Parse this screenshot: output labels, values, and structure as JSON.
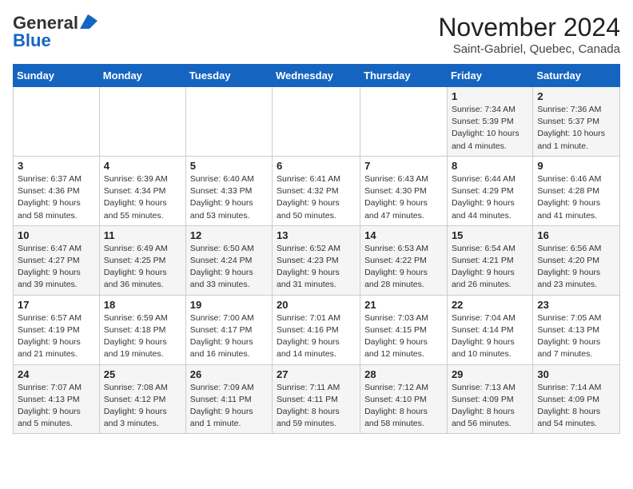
{
  "header": {
    "logo_line1": "General",
    "logo_line2": "Blue",
    "month": "November 2024",
    "location": "Saint-Gabriel, Quebec, Canada"
  },
  "days_of_week": [
    "Sunday",
    "Monday",
    "Tuesday",
    "Wednesday",
    "Thursday",
    "Friday",
    "Saturday"
  ],
  "weeks": [
    [
      {
        "day": "",
        "detail": ""
      },
      {
        "day": "",
        "detail": ""
      },
      {
        "day": "",
        "detail": ""
      },
      {
        "day": "",
        "detail": ""
      },
      {
        "day": "",
        "detail": ""
      },
      {
        "day": "1",
        "detail": "Sunrise: 7:34 AM\nSunset: 5:39 PM\nDaylight: 10 hours\nand 4 minutes."
      },
      {
        "day": "2",
        "detail": "Sunrise: 7:36 AM\nSunset: 5:37 PM\nDaylight: 10 hours\nand 1 minute."
      }
    ],
    [
      {
        "day": "3",
        "detail": "Sunrise: 6:37 AM\nSunset: 4:36 PM\nDaylight: 9 hours\nand 58 minutes."
      },
      {
        "day": "4",
        "detail": "Sunrise: 6:39 AM\nSunset: 4:34 PM\nDaylight: 9 hours\nand 55 minutes."
      },
      {
        "day": "5",
        "detail": "Sunrise: 6:40 AM\nSunset: 4:33 PM\nDaylight: 9 hours\nand 53 minutes."
      },
      {
        "day": "6",
        "detail": "Sunrise: 6:41 AM\nSunset: 4:32 PM\nDaylight: 9 hours\nand 50 minutes."
      },
      {
        "day": "7",
        "detail": "Sunrise: 6:43 AM\nSunset: 4:30 PM\nDaylight: 9 hours\nand 47 minutes."
      },
      {
        "day": "8",
        "detail": "Sunrise: 6:44 AM\nSunset: 4:29 PM\nDaylight: 9 hours\nand 44 minutes."
      },
      {
        "day": "9",
        "detail": "Sunrise: 6:46 AM\nSunset: 4:28 PM\nDaylight: 9 hours\nand 41 minutes."
      }
    ],
    [
      {
        "day": "10",
        "detail": "Sunrise: 6:47 AM\nSunset: 4:27 PM\nDaylight: 9 hours\nand 39 minutes."
      },
      {
        "day": "11",
        "detail": "Sunrise: 6:49 AM\nSunset: 4:25 PM\nDaylight: 9 hours\nand 36 minutes."
      },
      {
        "day": "12",
        "detail": "Sunrise: 6:50 AM\nSunset: 4:24 PM\nDaylight: 9 hours\nand 33 minutes."
      },
      {
        "day": "13",
        "detail": "Sunrise: 6:52 AM\nSunset: 4:23 PM\nDaylight: 9 hours\nand 31 minutes."
      },
      {
        "day": "14",
        "detail": "Sunrise: 6:53 AM\nSunset: 4:22 PM\nDaylight: 9 hours\nand 28 minutes."
      },
      {
        "day": "15",
        "detail": "Sunrise: 6:54 AM\nSunset: 4:21 PM\nDaylight: 9 hours\nand 26 minutes."
      },
      {
        "day": "16",
        "detail": "Sunrise: 6:56 AM\nSunset: 4:20 PM\nDaylight: 9 hours\nand 23 minutes."
      }
    ],
    [
      {
        "day": "17",
        "detail": "Sunrise: 6:57 AM\nSunset: 4:19 PM\nDaylight: 9 hours\nand 21 minutes."
      },
      {
        "day": "18",
        "detail": "Sunrise: 6:59 AM\nSunset: 4:18 PM\nDaylight: 9 hours\nand 19 minutes."
      },
      {
        "day": "19",
        "detail": "Sunrise: 7:00 AM\nSunset: 4:17 PM\nDaylight: 9 hours\nand 16 minutes."
      },
      {
        "day": "20",
        "detail": "Sunrise: 7:01 AM\nSunset: 4:16 PM\nDaylight: 9 hours\nand 14 minutes."
      },
      {
        "day": "21",
        "detail": "Sunrise: 7:03 AM\nSunset: 4:15 PM\nDaylight: 9 hours\nand 12 minutes."
      },
      {
        "day": "22",
        "detail": "Sunrise: 7:04 AM\nSunset: 4:14 PM\nDaylight: 9 hours\nand 10 minutes."
      },
      {
        "day": "23",
        "detail": "Sunrise: 7:05 AM\nSunset: 4:13 PM\nDaylight: 9 hours\nand 7 minutes."
      }
    ],
    [
      {
        "day": "24",
        "detail": "Sunrise: 7:07 AM\nSunset: 4:13 PM\nDaylight: 9 hours\nand 5 minutes."
      },
      {
        "day": "25",
        "detail": "Sunrise: 7:08 AM\nSunset: 4:12 PM\nDaylight: 9 hours\nand 3 minutes."
      },
      {
        "day": "26",
        "detail": "Sunrise: 7:09 AM\nSunset: 4:11 PM\nDaylight: 9 hours\nand 1 minute."
      },
      {
        "day": "27",
        "detail": "Sunrise: 7:11 AM\nSunset: 4:11 PM\nDaylight: 8 hours\nand 59 minutes."
      },
      {
        "day": "28",
        "detail": "Sunrise: 7:12 AM\nSunset: 4:10 PM\nDaylight: 8 hours\nand 58 minutes."
      },
      {
        "day": "29",
        "detail": "Sunrise: 7:13 AM\nSunset: 4:09 PM\nDaylight: 8 hours\nand 56 minutes."
      },
      {
        "day": "30",
        "detail": "Sunrise: 7:14 AM\nSunset: 4:09 PM\nDaylight: 8 hours\nand 54 minutes."
      }
    ]
  ]
}
